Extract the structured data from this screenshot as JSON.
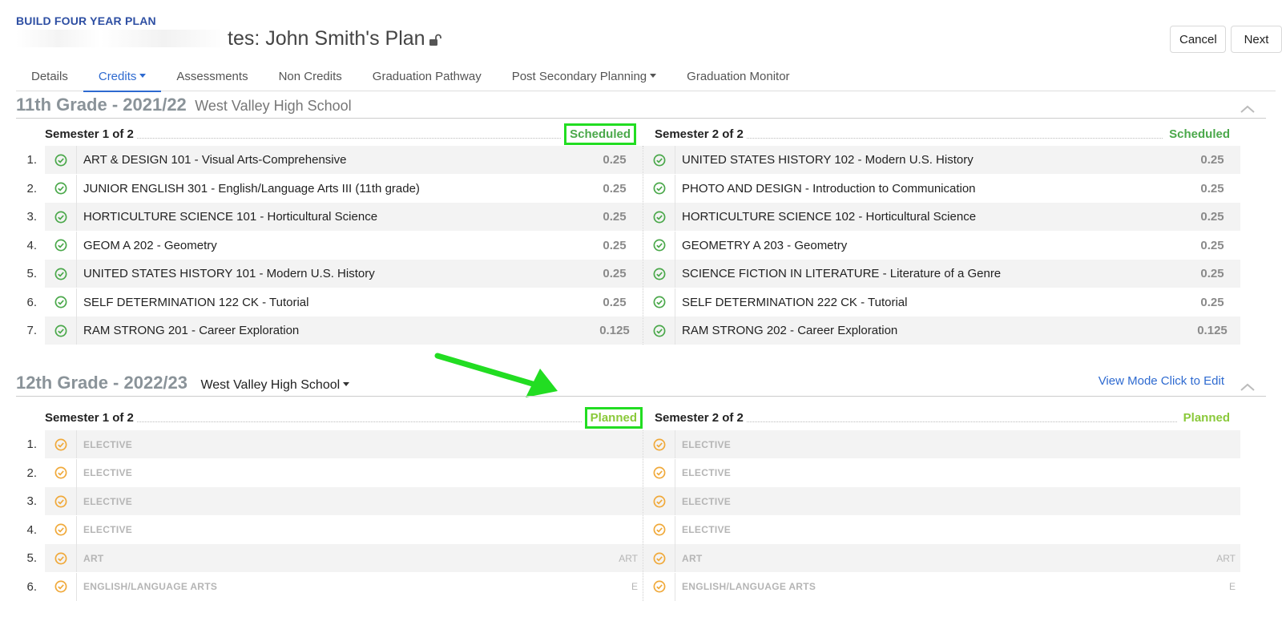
{
  "header": {
    "kicker": "BUILD FOUR YEAR PLAN",
    "plan_title_suffix": "tes: John Smith's Plan",
    "cancel_label": "Cancel",
    "next_label": "Next"
  },
  "tabs": [
    {
      "label": "Details"
    },
    {
      "label": "Credits",
      "dropdown": true,
      "active": true
    },
    {
      "label": "Assessments"
    },
    {
      "label": "Non Credits"
    },
    {
      "label": "Graduation Pathway"
    },
    {
      "label": "Post Secondary Planning",
      "dropdown": true
    },
    {
      "label": "Graduation Monitor"
    }
  ],
  "colors": {
    "accent": "#2e6ad0",
    "scheduled": "#4aa84a",
    "planned": "#8ac93a",
    "highlight": "#22dd22",
    "pending_icon": "#f0a93a"
  },
  "grade11": {
    "title": "11th Grade - 2021/22",
    "school": "West Valley High School",
    "sem1": {
      "label": "Semester 1 of 2",
      "status": "Scheduled"
    },
    "sem2": {
      "label": "Semester 2 of 2",
      "status": "Scheduled"
    },
    "rows": [
      {
        "num": "1.",
        "s1": "ART & DESIGN 101 - Visual Arts-Comprehensive",
        "c1": "0.25",
        "s2": "UNITED STATES HISTORY 102 - Modern U.S. History",
        "c2": "0.25"
      },
      {
        "num": "2.",
        "s1": "JUNIOR ENGLISH 301 - English/Language Arts III (11th grade)",
        "c1": "0.25",
        "s2": "PHOTO AND DESIGN - Introduction to Communication",
        "c2": "0.25"
      },
      {
        "num": "3.",
        "s1": "HORTICULTURE SCIENCE 101 - Horticultural Science",
        "c1": "0.25",
        "s2": "HORTICULTURE SCIENCE 102 - Horticultural Science",
        "c2": "0.25"
      },
      {
        "num": "4.",
        "s1": "GEOM A 202 - Geometry",
        "c1": "0.25",
        "s2": "GEOMETRY A 203 - Geometry",
        "c2": "0.25"
      },
      {
        "num": "5.",
        "s1": "UNITED STATES HISTORY 101 - Modern U.S. History",
        "c1": "0.25",
        "s2": "SCIENCE FICTION IN LITERATURE - Literature of a Genre",
        "c2": "0.25"
      },
      {
        "num": "6.",
        "s1": "SELF DETERMINATION 122 CK - Tutorial",
        "c1": "0.25",
        "s2": "SELF DETERMINATION 222 CK - Tutorial",
        "c2": "0.25"
      },
      {
        "num": "7.",
        "s1": "RAM STRONG 201 - Career Exploration",
        "c1": "0.125",
        "s2": "RAM STRONG 202 - Career Exploration",
        "c2": "0.125"
      }
    ]
  },
  "grade12": {
    "title": "12th Grade - 2022/23",
    "school": "West Valley High School",
    "view_mode": "View Mode Click to Edit",
    "sem1": {
      "label": "Semester 1 of 2",
      "status": "Planned"
    },
    "sem2": {
      "label": "Semester 2 of 2",
      "status": "Planned"
    },
    "rows": [
      {
        "num": "1.",
        "s1": "ELECTIVE",
        "a1": "",
        "s2": "ELECTIVE",
        "a2": ""
      },
      {
        "num": "2.",
        "s1": "ELECTIVE",
        "a1": "",
        "s2": "ELECTIVE",
        "a2": ""
      },
      {
        "num": "3.",
        "s1": "ELECTIVE",
        "a1": "",
        "s2": "ELECTIVE",
        "a2": ""
      },
      {
        "num": "4.",
        "s1": "ELECTIVE",
        "a1": "",
        "s2": "ELECTIVE",
        "a2": ""
      },
      {
        "num": "5.",
        "s1": "ART",
        "a1": "ART",
        "s2": "ART",
        "a2": "ART"
      },
      {
        "num": "6.",
        "s1": "ENGLISH/LANGUAGE ARTS",
        "a1": "E",
        "s2": "ENGLISH/LANGUAGE ARTS",
        "a2": "E"
      }
    ]
  }
}
